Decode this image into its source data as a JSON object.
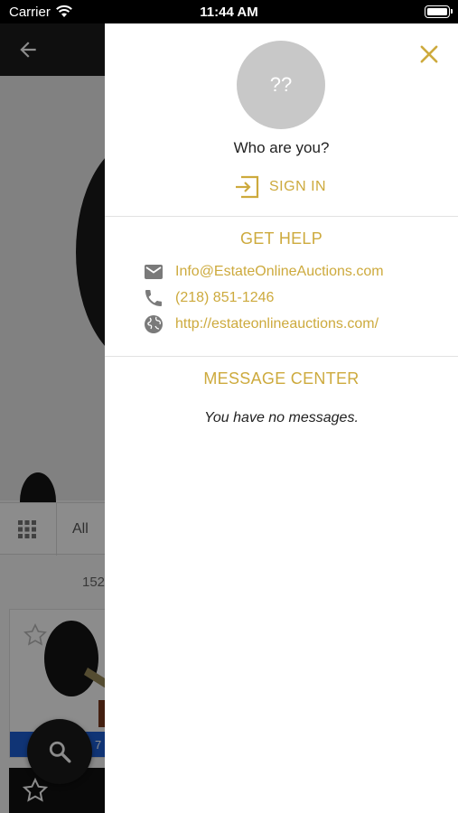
{
  "status_bar": {
    "carrier": "Carrier",
    "time": "11:44 AM"
  },
  "background": {
    "filter_label": "All",
    "item_count": "152",
    "card_price": "7"
  },
  "drawer": {
    "avatar_text": "??",
    "who_text": "Who are you?",
    "sign_in_label": "SIGN IN",
    "get_help_title": "GET HELP",
    "email": "Info@EstateOnlineAuctions.com",
    "phone": "(218) 851-1246",
    "website": "http://estateonlineauctions.com/",
    "message_center_title": "MESSAGE CENTER",
    "no_messages": "You have no messages."
  },
  "colors": {
    "accent": "#cdaa3d",
    "icon_gray": "#7a7a7a",
    "header_dark": "#1d1d1d",
    "price_blue": "#1e5fd6"
  },
  "icons": [
    "wifi-icon",
    "battery-icon",
    "back-arrow-icon",
    "grid-icon",
    "star-icon",
    "search-icon",
    "close-icon",
    "sign-in-icon",
    "email-icon",
    "phone-icon",
    "globe-icon"
  ]
}
